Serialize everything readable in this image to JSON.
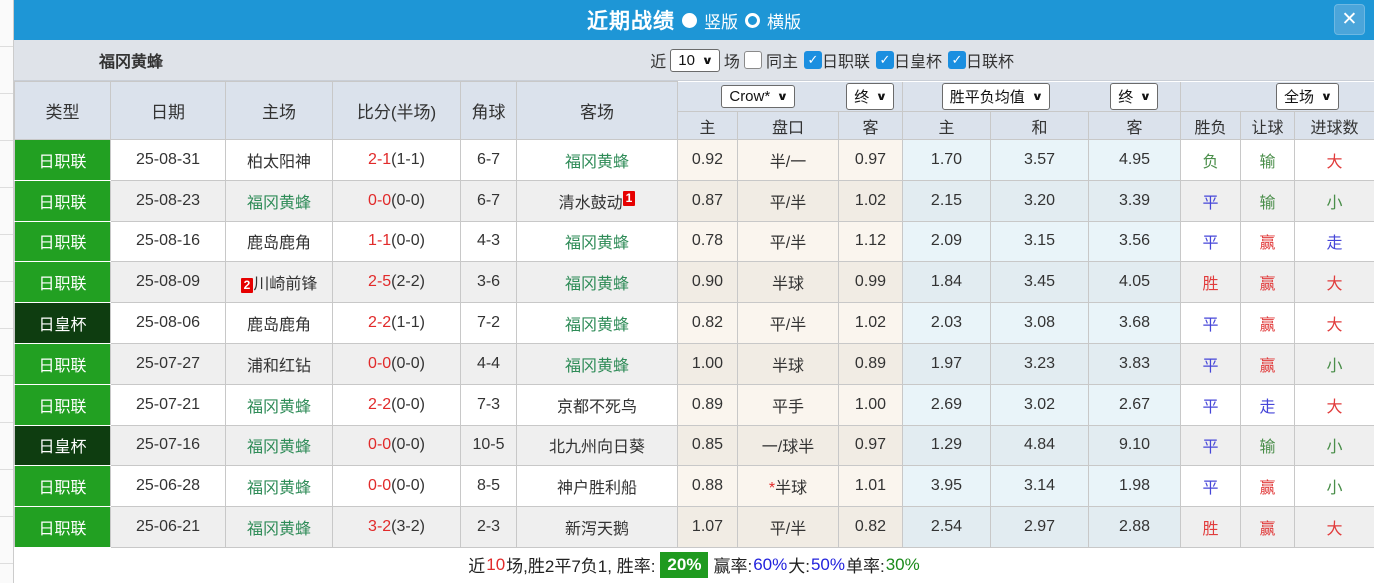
{
  "titlebar": {
    "title": "近期战绩",
    "vertical_label": "竖版",
    "horizontal_label": "横版",
    "close_label": "✕"
  },
  "filter": {
    "team_name": "福冈黄蜂",
    "near_label": "近",
    "near_count": "10",
    "unit_label": "场",
    "same_home_label": "同主",
    "league_labels": [
      "日职联",
      "日皇杯",
      "日联杯"
    ]
  },
  "table": {
    "selects": {
      "company": "Crow*",
      "time1": "终",
      "avg": "胜平负均值",
      "time2": "终",
      "scope": "全场"
    },
    "main_headers": [
      "类型",
      "日期",
      "主场",
      "比分(半场)",
      "角球",
      "客场"
    ],
    "sub_headers": [
      "主",
      "盘口",
      "客",
      "主",
      "和",
      "客",
      "胜负",
      "让球",
      "进球数"
    ],
    "rows": [
      {
        "type": "日职联",
        "cup": false,
        "date": "25-08-31",
        "home": "柏太阳神",
        "home_self": false,
        "home_badge": "",
        "score": "2-1",
        "half": "(1-1)",
        "corner": "6-7",
        "away": "福冈黄蜂",
        "away_self": true,
        "away_badge": "",
        "ah_home": "0.92",
        "ah_star": false,
        "ah_line": "半/一",
        "ah_away": "0.97",
        "eu_home": "1.70",
        "eu_draw": "3.57",
        "eu_away": "4.95",
        "result": "负",
        "result_color": "green",
        "ah_result": "输",
        "ah_result_color": "green",
        "ou_result": "大",
        "ou_result_color": "red"
      },
      {
        "type": "日职联",
        "cup": false,
        "date": "25-08-23",
        "home": "福冈黄蜂",
        "home_self": true,
        "home_badge": "",
        "score": "0-0",
        "half": "(0-0)",
        "corner": "6-7",
        "away": "清水鼓动",
        "away_self": false,
        "away_badge": "1",
        "ah_home": "0.87",
        "ah_star": false,
        "ah_line": "平/半",
        "ah_away": "1.02",
        "eu_home": "2.15",
        "eu_draw": "3.20",
        "eu_away": "3.39",
        "result": "平",
        "result_color": "blue",
        "ah_result": "输",
        "ah_result_color": "green",
        "ou_result": "小",
        "ou_result_color": "green"
      },
      {
        "type": "日职联",
        "cup": false,
        "date": "25-08-16",
        "home": "鹿岛鹿角",
        "home_self": false,
        "home_badge": "",
        "score": "1-1",
        "half": "(0-0)",
        "corner": "4-3",
        "away": "福冈黄蜂",
        "away_self": true,
        "away_badge": "",
        "ah_home": "0.78",
        "ah_star": false,
        "ah_line": "平/半",
        "ah_away": "1.12",
        "eu_home": "2.09",
        "eu_draw": "3.15",
        "eu_away": "3.56",
        "result": "平",
        "result_color": "blue",
        "ah_result": "赢",
        "ah_result_color": "red",
        "ou_result": "走",
        "ou_result_color": "blue"
      },
      {
        "type": "日职联",
        "cup": false,
        "date": "25-08-09",
        "home": "川崎前锋",
        "home_self": false,
        "home_badge": "2",
        "score": "2-5",
        "half": "(2-2)",
        "corner": "3-6",
        "away": "福冈黄蜂",
        "away_self": true,
        "away_badge": "",
        "ah_home": "0.90",
        "ah_star": false,
        "ah_line": "半球",
        "ah_away": "0.99",
        "eu_home": "1.84",
        "eu_draw": "3.45",
        "eu_away": "4.05",
        "result": "胜",
        "result_color": "red",
        "ah_result": "赢",
        "ah_result_color": "red",
        "ou_result": "大",
        "ou_result_color": "red"
      },
      {
        "type": "日皇杯",
        "cup": true,
        "date": "25-08-06",
        "home": "鹿岛鹿角",
        "home_self": false,
        "home_badge": "",
        "score": "2-2",
        "half": "(1-1)",
        "corner": "7-2",
        "away": "福冈黄蜂",
        "away_self": true,
        "away_badge": "",
        "ah_home": "0.82",
        "ah_star": false,
        "ah_line": "平/半",
        "ah_away": "1.02",
        "eu_home": "2.03",
        "eu_draw": "3.08",
        "eu_away": "3.68",
        "result": "平",
        "result_color": "blue",
        "ah_result": "赢",
        "ah_result_color": "red",
        "ou_result": "大",
        "ou_result_color": "red"
      },
      {
        "type": "日职联",
        "cup": false,
        "date": "25-07-27",
        "home": "浦和红钻",
        "home_self": false,
        "home_badge": "",
        "score": "0-0",
        "half": "(0-0)",
        "corner": "4-4",
        "away": "福冈黄蜂",
        "away_self": true,
        "away_badge": "",
        "ah_home": "1.00",
        "ah_star": false,
        "ah_line": "半球",
        "ah_away": "0.89",
        "eu_home": "1.97",
        "eu_draw": "3.23",
        "eu_away": "3.83",
        "result": "平",
        "result_color": "blue",
        "ah_result": "赢",
        "ah_result_color": "red",
        "ou_result": "小",
        "ou_result_color": "green"
      },
      {
        "type": "日职联",
        "cup": false,
        "date": "25-07-21",
        "home": "福冈黄蜂",
        "home_self": true,
        "home_badge": "",
        "score": "2-2",
        "half": "(0-0)",
        "corner": "7-3",
        "away": "京都不死鸟",
        "away_self": false,
        "away_badge": "",
        "ah_home": "0.89",
        "ah_star": false,
        "ah_line": "平手",
        "ah_away": "1.00",
        "eu_home": "2.69",
        "eu_draw": "3.02",
        "eu_away": "2.67",
        "result": "平",
        "result_color": "blue",
        "ah_result": "走",
        "ah_result_color": "blue",
        "ou_result": "大",
        "ou_result_color": "red"
      },
      {
        "type": "日皇杯",
        "cup": true,
        "date": "25-07-16",
        "home": "福冈黄蜂",
        "home_self": true,
        "home_badge": "",
        "score": "0-0",
        "half": "(0-0)",
        "corner": "10-5",
        "away": "北九州向日葵",
        "away_self": false,
        "away_badge": "",
        "ah_home": "0.85",
        "ah_star": false,
        "ah_line": "一/球半",
        "ah_away": "0.97",
        "eu_home": "1.29",
        "eu_draw": "4.84",
        "eu_away": "9.10",
        "result": "平",
        "result_color": "blue",
        "ah_result": "输",
        "ah_result_color": "green",
        "ou_result": "小",
        "ou_result_color": "green"
      },
      {
        "type": "日职联",
        "cup": false,
        "date": "25-06-28",
        "home": "福冈黄蜂",
        "home_self": true,
        "home_badge": "",
        "score": "0-0",
        "half": "(0-0)",
        "corner": "8-5",
        "away": "神户胜利船",
        "away_self": false,
        "away_badge": "",
        "ah_home": "0.88",
        "ah_star": true,
        "ah_line": "半球",
        "ah_away": "1.01",
        "eu_home": "3.95",
        "eu_draw": "3.14",
        "eu_away": "1.98",
        "result": "平",
        "result_color": "blue",
        "ah_result": "赢",
        "ah_result_color": "red",
        "ou_result": "小",
        "ou_result_color": "green"
      },
      {
        "type": "日职联",
        "cup": false,
        "date": "25-06-21",
        "home": "福冈黄蜂",
        "home_self": true,
        "home_badge": "",
        "score": "3-2",
        "half": "(3-2)",
        "corner": "2-3",
        "away": "新泻天鹅",
        "away_self": false,
        "away_badge": "",
        "ah_home": "1.07",
        "ah_star": false,
        "ah_line": "平/半",
        "ah_away": "0.82",
        "eu_home": "2.54",
        "eu_draw": "2.97",
        "eu_away": "2.88",
        "result": "胜",
        "result_color": "red",
        "ah_result": "赢",
        "ah_result_color": "red",
        "ou_result": "大",
        "ou_result_color": "red"
      }
    ]
  },
  "summary": {
    "segments": [
      {
        "text": "近",
        "style": "dark"
      },
      {
        "text": "10",
        "style": "red"
      },
      {
        "text": "场,胜2平7负1, 胜率:",
        "style": "dark"
      },
      {
        "text": "20%",
        "style": "badge"
      },
      {
        "text": "赢率:",
        "style": "dark"
      },
      {
        "text": "60%",
        "style": "blue"
      },
      {
        "text": " 大:",
        "style": "dark"
      },
      {
        "text": "50%",
        "style": "blue"
      },
      {
        "text": " 单率:",
        "style": "dark"
      },
      {
        "text": "30%",
        "style": "green"
      }
    ]
  },
  "colors": {
    "header_blue": "#1e96d6",
    "league_green": "#22a022",
    "cup_dark_green": "#0e3d10",
    "self_team_green": "#2e8b57",
    "score_red": "#e12a2a",
    "result_red": "#e13c3c",
    "result_blue": "#4646d8",
    "result_green": "#4a8e4a",
    "win_rate_badge_green": "#1f9a1f"
  }
}
